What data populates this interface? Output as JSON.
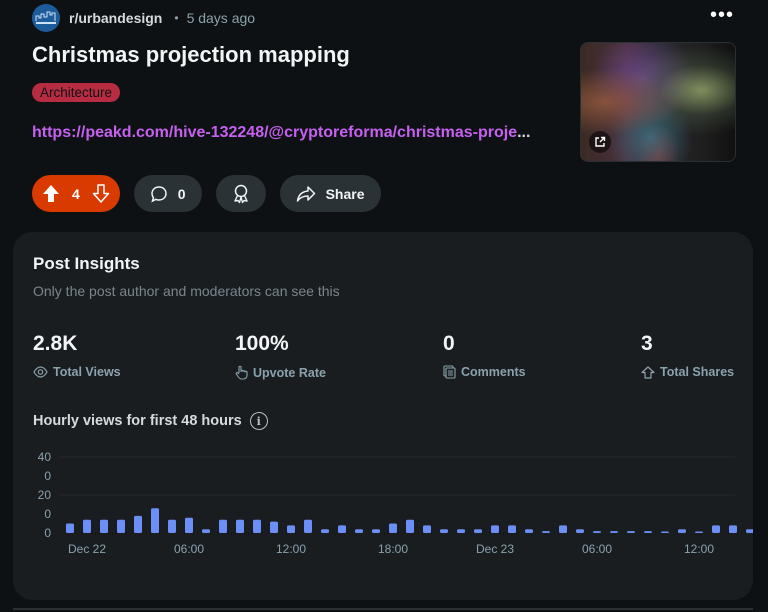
{
  "post": {
    "subreddit": "r/urbandesign",
    "separator": "•",
    "age": "5 days ago",
    "more_icon": "more-horizontal-icon",
    "more_label": "•••",
    "title": "Christmas projection mapping",
    "flair": "Architecture",
    "link_text": "https://peakd.com/hive-132248/@cryptoreforma/christmas-proje",
    "link_ellipsis": "...",
    "thumbnail_icon": "external-link-icon"
  },
  "actions": {
    "vote_count": "4",
    "comment_count": "0",
    "award_icon": "award-icon",
    "share_label": "Share"
  },
  "insights": {
    "title": "Post Insights",
    "subtitle": "Only the post author and moderators can see this",
    "stats": [
      {
        "value": "2.8K",
        "label": "Total Views",
        "icon": "eye-icon"
      },
      {
        "value": "100%",
        "label": "Upvote Rate",
        "icon": "hand-pointer-icon"
      },
      {
        "value": "0",
        "label": "Comments",
        "icon": "comments-icon"
      },
      {
        "value": "3",
        "label": "Total Shares",
        "icon": "share-up-icon"
      }
    ],
    "chart_title": "Hourly views for first 48 hours",
    "info_icon": "i"
  },
  "colors": {
    "upvote_bg": "#d93a00",
    "flair_bg": "#b82c42",
    "link": "#c660f0",
    "bar": "#6c8ff7"
  },
  "chart_data": {
    "type": "bar",
    "title": "Hourly views for first 48 hours",
    "xlabel": "",
    "ylabel": "",
    "y_tick_labels": [
      "40",
      "0",
      "20",
      "0",
      "0"
    ],
    "ylim": [
      0,
      40
    ],
    "grid": true,
    "x_tick_labels": [
      "Dec 22",
      "06:00",
      "12:00",
      "18:00",
      "Dec 23",
      "06:00",
      "12:00"
    ],
    "x_tick_bar_index": [
      1,
      7,
      13,
      19,
      25,
      31,
      37
    ],
    "values": [
      5,
      7,
      7,
      7,
      9,
      13,
      7,
      8,
      2,
      7,
      7,
      7,
      6,
      4,
      7,
      2,
      4,
      2,
      2,
      5,
      7,
      4,
      2,
      2,
      2,
      4,
      4,
      2,
      1,
      4,
      2,
      1,
      1,
      1,
      1,
      0.5,
      2,
      0.5,
      4,
      4,
      2
    ]
  }
}
